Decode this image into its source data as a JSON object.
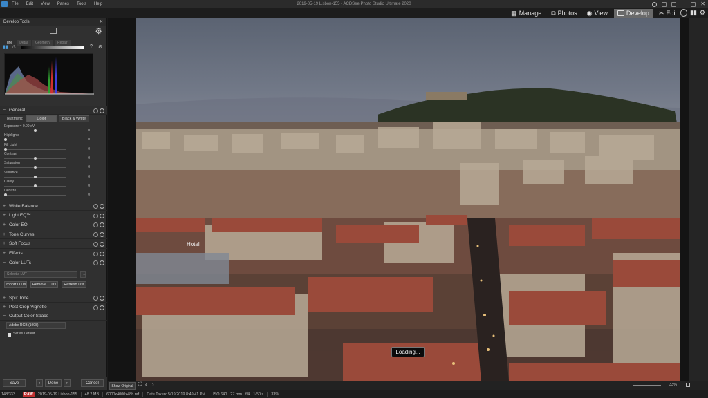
{
  "window": {
    "title": "2019-05-19 Lisbon-155 - ACDSee Photo Studio Ultimate 2020"
  },
  "menu": [
    "File",
    "Edit",
    "View",
    "Panes",
    "Tools",
    "Help"
  ],
  "modes": [
    {
      "label": "Manage",
      "icon": "grid-icon"
    },
    {
      "label": "Photos",
      "icon": "photos-icon"
    },
    {
      "label": "View",
      "icon": "eye-icon"
    },
    {
      "label": "Develop",
      "icon": "develop-icon",
      "active": true
    },
    {
      "label": "Edit",
      "icon": "brush-icon"
    }
  ],
  "panel": {
    "title": "Develop Tools",
    "tabs": [
      "Tune",
      "Detail",
      "Geometry",
      "Repair"
    ],
    "general": {
      "title": "General",
      "treatment_label": "Treatment:",
      "color_btn": "Color",
      "bw_btn": "Black & White",
      "sliders": [
        {
          "label": "Exposure = 0.00 eV",
          "value": "0",
          "pos": 0.5
        },
        {
          "label": "Highlights",
          "value": "0",
          "pos": 0.02
        },
        {
          "label": "Fill Light",
          "value": "0",
          "pos": 0.02
        },
        {
          "label": "Contrast",
          "value": "0",
          "pos": 0.5
        },
        {
          "label": "Saturation",
          "value": "0",
          "pos": 0.5
        },
        {
          "label": "Vibrance",
          "value": "0",
          "pos": 0.5
        },
        {
          "label": "Clarity",
          "value": "0",
          "pos": 0.5
        },
        {
          "label": "Dehaze",
          "value": "0",
          "pos": 0.02
        }
      ]
    },
    "sections_a": [
      "White Balance",
      "Light EQ™",
      "Color EQ",
      "Tone Curves",
      "Soft Focus",
      "Effects",
      "Color LUTs"
    ],
    "lut": {
      "placeholder": "Select a LUT",
      "import": "Import LUTs",
      "remove": "Remove LUTs",
      "refresh": "Refresh List"
    },
    "sections_b": [
      "Split Tone",
      "Post-Crop Vignette"
    ],
    "output": {
      "title": "Output Color Space",
      "value": "Adobe RGB (1998)",
      "default_label": "Set as Default"
    },
    "footer": {
      "save": "Save",
      "done": "Done",
      "cancel": "Cancel"
    }
  },
  "viewer": {
    "loading": "Loading...",
    "hotel_sign": "Hotel",
    "show_original": "Show Original",
    "zoom": "33%"
  },
  "status": {
    "count": "148/333",
    "raw": "RAW",
    "filename": "2019-05-19 Lisbon-155",
    "size": "48.2 MB",
    "dims": "6000x4000x48b raf",
    "date": "Date Taken: 5/19/2019 8:49:41 PM",
    "iso": "ISO 640",
    "focal": "27 mm",
    "aperture": "f/4",
    "shutter": "1/50 s",
    "zoom": "33%"
  }
}
